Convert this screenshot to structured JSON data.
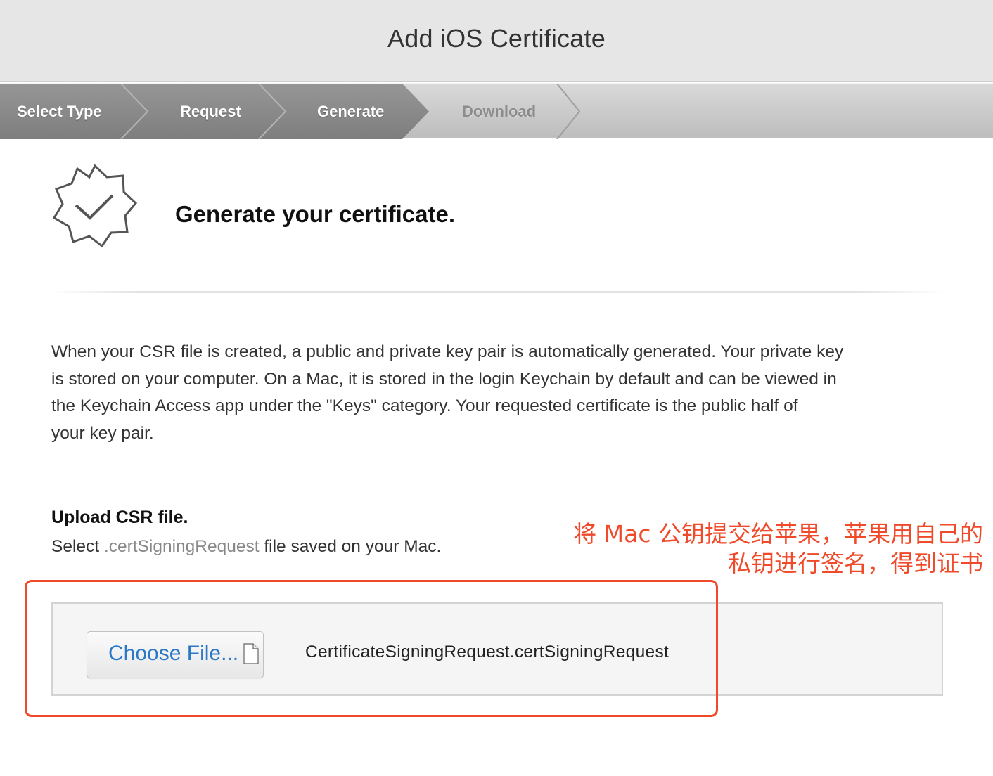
{
  "header": {
    "title": "Add iOS Certificate"
  },
  "steps": [
    {
      "label": "Select Type",
      "state": "completed"
    },
    {
      "label": "Request",
      "state": "completed"
    },
    {
      "label": "Generate",
      "state": "current"
    },
    {
      "label": "Download",
      "state": "upcoming"
    }
  ],
  "main": {
    "heading": "Generate your certificate.",
    "intro_lines": [
      "When your CSR file is created, a public and private key pair is automatically generated. Your private key",
      "is stored on your computer. On a Mac, it is stored in the login Keychain by default and can be viewed in",
      "the Keychain Access app under the \"Keys\" category. Your requested certificate is the public half of",
      "your key pair."
    ],
    "upload": {
      "title": "Upload CSR file.",
      "sub_prefix": "Select",
      "sub_ext": " .certSigningRequest",
      "sub_suffix": " file saved on your Mac.",
      "choose_label": "Choose File...",
      "file_name": "CertificateSigningRequest.certSigningRequest"
    }
  },
  "annotation": {
    "line1": "将 Mac 公钥提交给苹果，苹果用自己的",
    "line2": "私钥进行签名，得到证书"
  },
  "colors": {
    "annotation": "#f04a2b",
    "link_blue": "#2b78c6",
    "step_active": "#8a8a8a"
  },
  "icons": {
    "badge": "verified-badge-icon",
    "file": "document-icon"
  }
}
